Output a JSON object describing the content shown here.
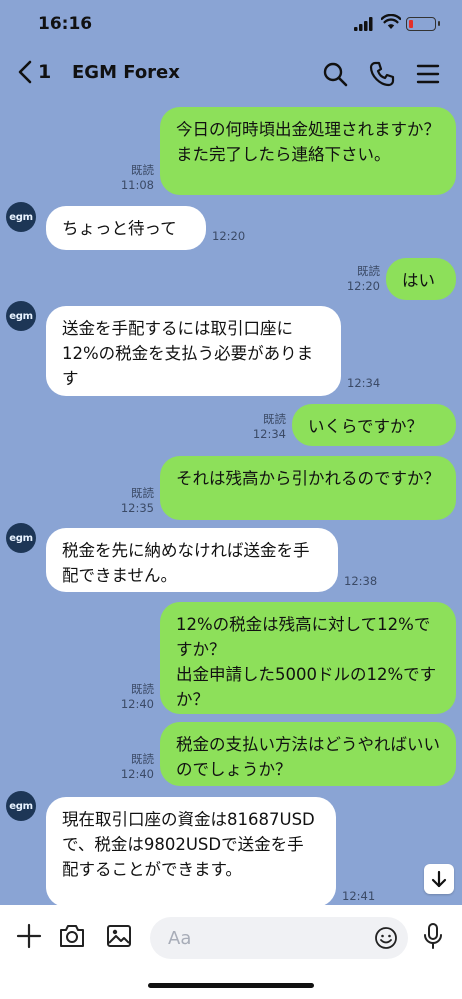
{
  "status_bar": {
    "time": "16:16"
  },
  "header": {
    "back_count": "1",
    "title": "EGM Forex"
  },
  "avatar_text": "egm",
  "messages": [
    {
      "text": "今日の何時頃出金処理されますか？また完了したら連絡下さい。",
      "read": "既読",
      "time": "11:08"
    },
    {
      "text": "ちょっと待って",
      "time": "12:20"
    },
    {
      "text": "はい",
      "read": "既読",
      "time": "12:20"
    },
    {
      "text": "送金を手配するには取引口座に12%の税金を支払う必要があります",
      "time": "12:34"
    },
    {
      "text": "いくらですか？",
      "read": "既読",
      "time": "12:34"
    },
    {
      "text": "それは残高から引かれるのですか？",
      "read": "既読",
      "time": "12:35"
    },
    {
      "text": "税金を先に納めなければ送金を手配できません。",
      "time": "12:38"
    },
    {
      "text": "12%の税金は残高に対して12%ですか？\n出金申請した5000ドルの12%ですか？",
      "read": "既読",
      "time": "12:40"
    },
    {
      "text": "税金の支払い方法はどうやればいいのでしょうか？",
      "read": "既読",
      "time": "12:40"
    },
    {
      "text": "現在取引口座の資金は81687USDで、税金は9802USDで送金を手配することができます。",
      "time": "12:41"
    }
  ],
  "input": {
    "placeholder": "Aa"
  }
}
